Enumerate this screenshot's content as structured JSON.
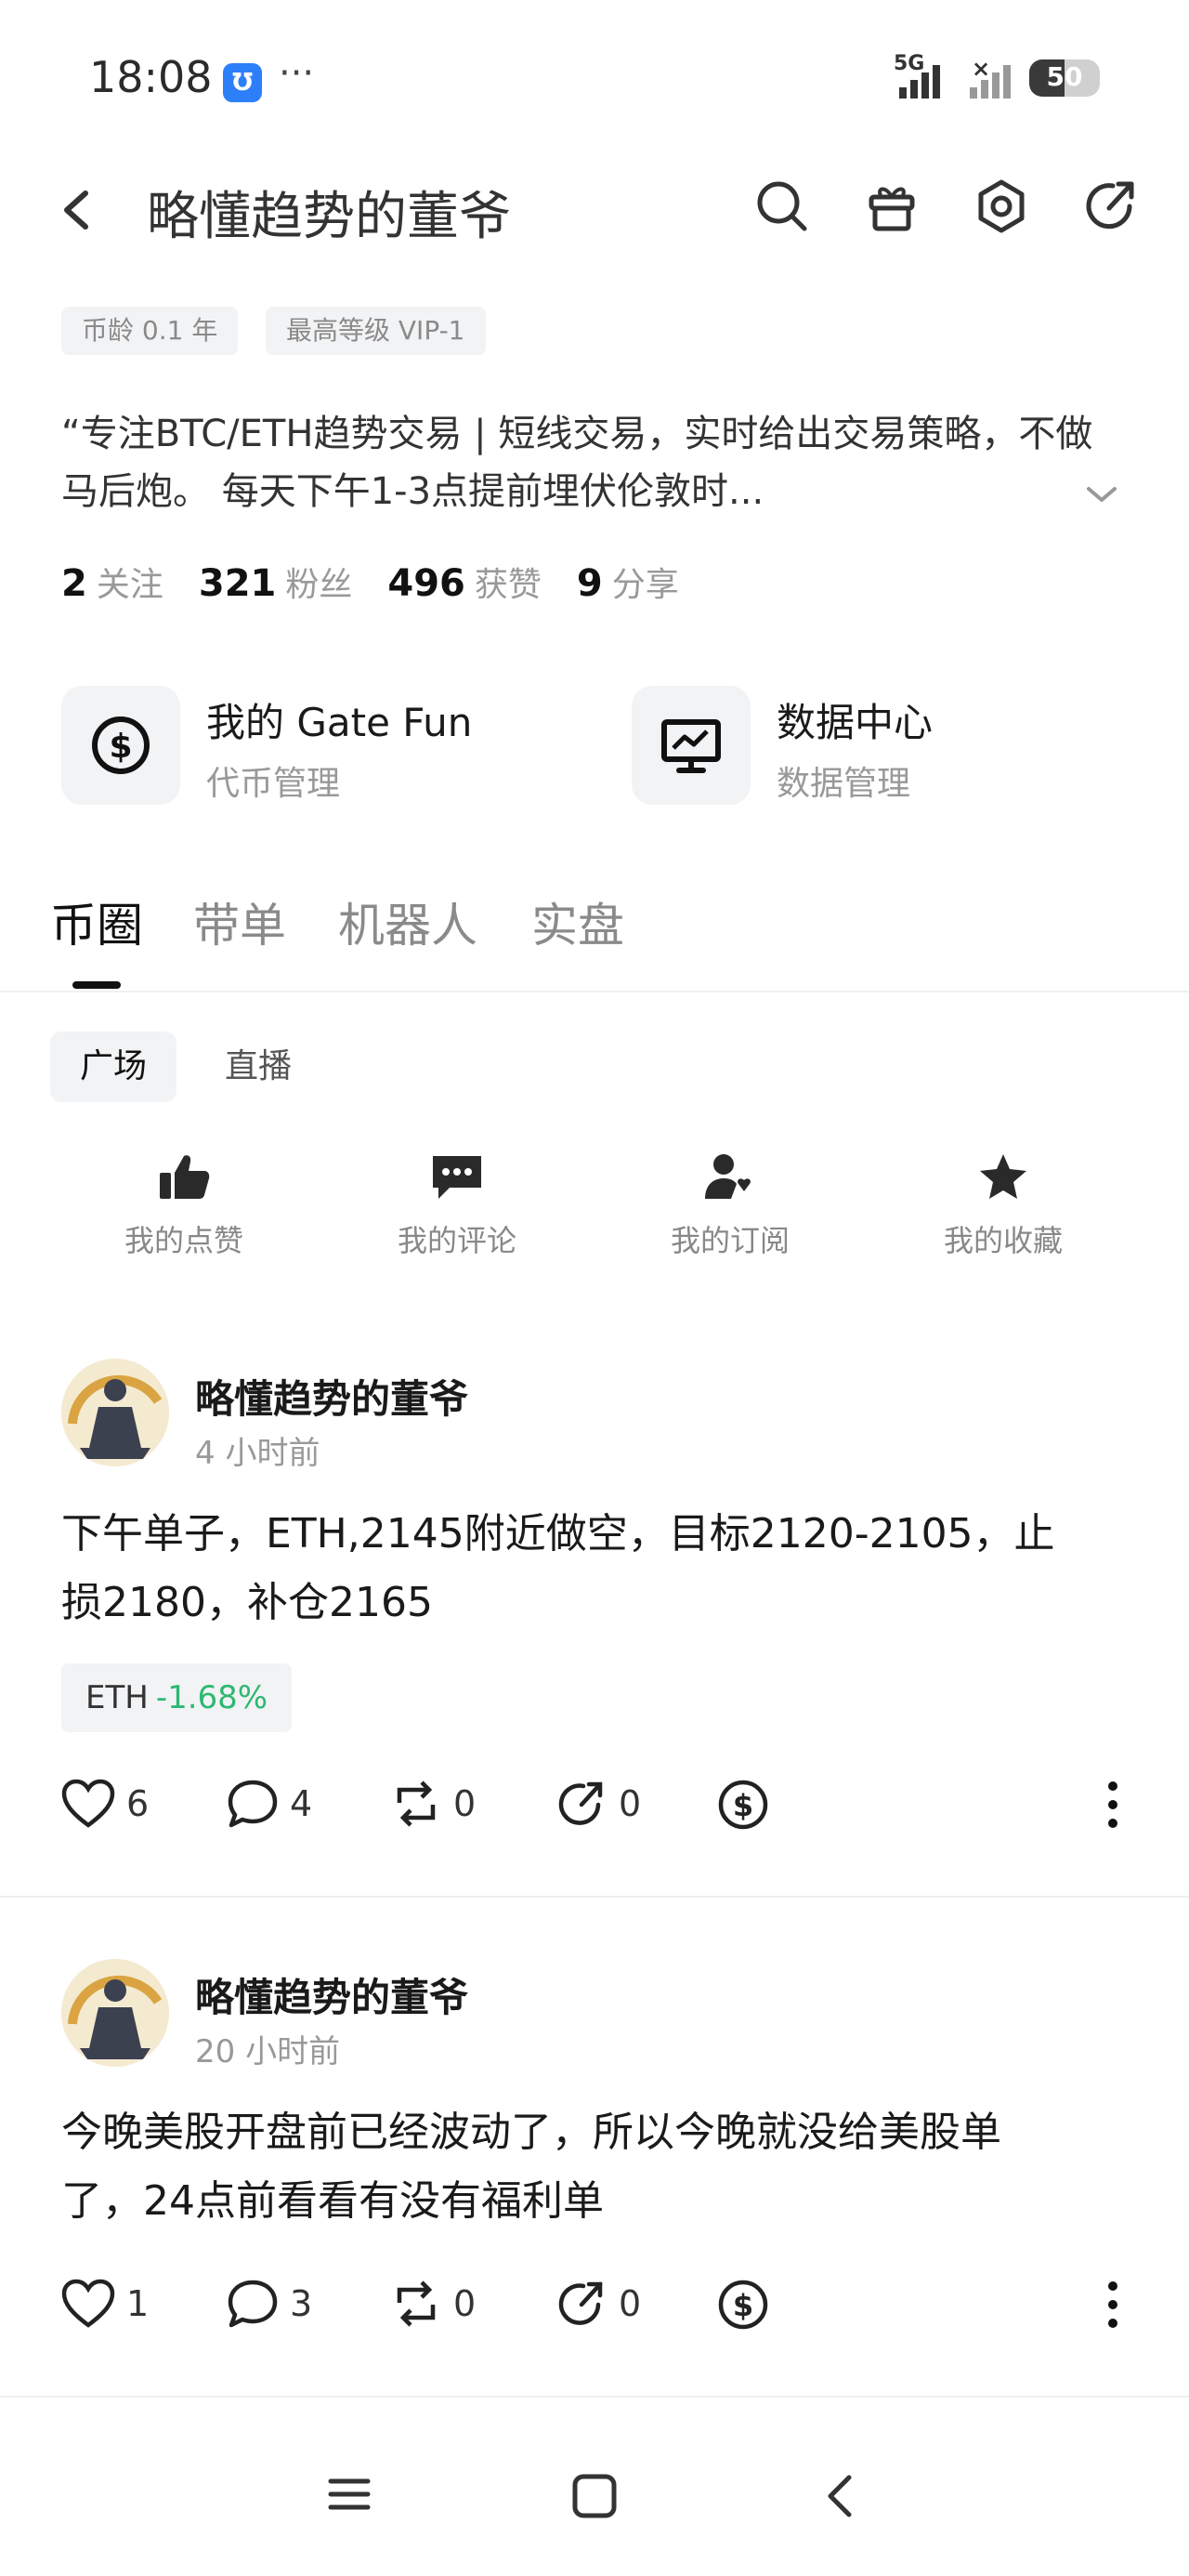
{
  "status": {
    "time": "18:08",
    "app_badge": "Ʊ",
    "dots": "···",
    "network": "5G",
    "battery": "50"
  },
  "header": {
    "title": "略懂趋势的董爷"
  },
  "tags": [
    "币龄 0.1 年",
    "最高等级 VIP-1"
  ],
  "bio": "“专注BTC/ETH趋势交易 | 短线交易，实时给出交易策略，不做马后炮。 每天下午1-3点提前埋伏伦敦时...",
  "stats": [
    {
      "num": "2",
      "label": "关注"
    },
    {
      "num": "321",
      "label": "粉丝"
    },
    {
      "num": "496",
      "label": "获赞"
    },
    {
      "num": "9",
      "label": "分享"
    }
  ],
  "cards": [
    {
      "title": "我的 Gate Fun",
      "subtitle": "代币管理",
      "icon": "dollar-circle-icon"
    },
    {
      "title": "数据中心",
      "subtitle": "数据管理",
      "icon": "chart-monitor-icon"
    }
  ],
  "tabs": [
    "币圈",
    "带单",
    "机器人",
    "实盘"
  ],
  "subtabs": [
    "广场",
    "直播"
  ],
  "quick_actions": [
    {
      "label": "我的点赞",
      "icon": "thumbs-up-icon"
    },
    {
      "label": "我的评论",
      "icon": "comment-icon"
    },
    {
      "label": "我的订阅",
      "icon": "subscribe-user-icon"
    },
    {
      "label": "我的收藏",
      "icon": "star-icon"
    }
  ],
  "posts": [
    {
      "author": "略懂趋势的董爷",
      "time": "4 小时前",
      "body_line1": "下午单子，ETH,2145附近做空，目标2120-2105，止",
      "body_line2": "损2180，补仓2165",
      "coin": {
        "symbol": "ETH",
        "change": "-1.68%"
      },
      "likes": "6",
      "comments": "4",
      "reposts": "0",
      "shares": "0"
    },
    {
      "author": "略懂趋势的董爷",
      "time": "20 小时前",
      "body_line1": "今晚美股开盘前已经波动了，所以今晚就没给美股单",
      "body_line2": "了，24点前看看有没有福利单",
      "likes": "1",
      "comments": "3",
      "reposts": "0",
      "shares": "0"
    }
  ],
  "colors": {
    "positive": "#2eb872",
    "muted": "#999999",
    "tag_bg": "#f2f3f5"
  }
}
